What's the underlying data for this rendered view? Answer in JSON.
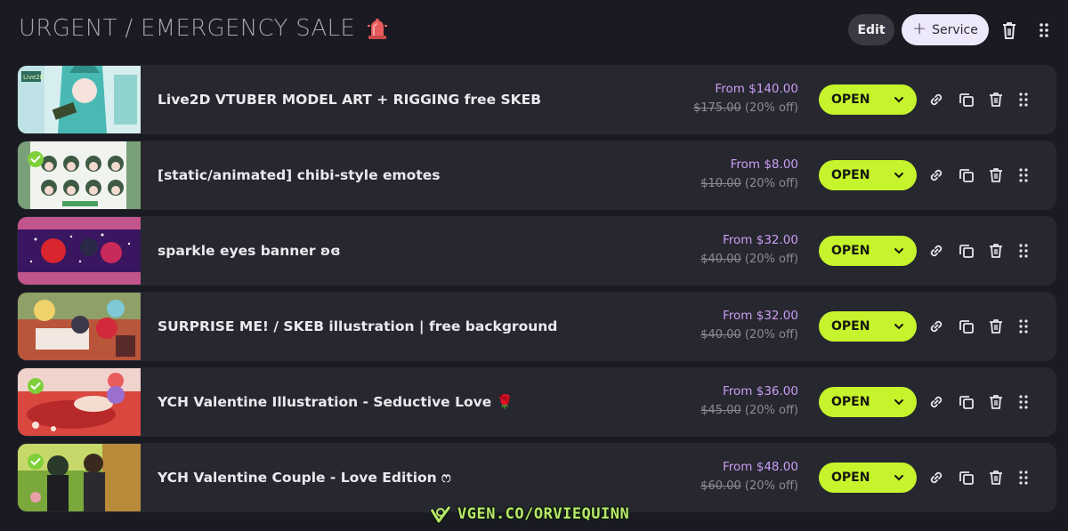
{
  "header": {
    "title": "URGENT / EMERGENCY SALE",
    "siren_icon": "police-siren-icon",
    "edit_label": "Edit",
    "service_label": "Service",
    "service_icon": "plus-icon"
  },
  "colors": {
    "background": "#1a1a23",
    "row_background": "#272730",
    "accent_open": "#c6f42c",
    "price_from": "#c99ef2",
    "price_orig": "#8b8b95",
    "service_button": "#eee8fb"
  },
  "services": [
    {
      "name": "Live2D VTUBER MODEL ART + RIGGING free SKEB",
      "from": "From $140.00",
      "original": "$175.00",
      "discount": "(20% off)",
      "status": "OPEN",
      "verified": false
    },
    {
      "name": "[static/animated] chibi-style emotes",
      "from": "From $8.00",
      "original": "$10.00",
      "discount": "(20% off)",
      "status": "OPEN",
      "verified": true
    },
    {
      "name": "sparkle eyes banner ʚɞ",
      "from": "From $32.00",
      "original": "$40.00",
      "discount": "(20% off)",
      "status": "OPEN",
      "verified": false
    },
    {
      "name": "SURPRISE ME! / SKEB illustration | free background",
      "from": "From $32.00",
      "original": "$40.00",
      "discount": "(20% off)",
      "status": "OPEN",
      "verified": false
    },
    {
      "name": "YCH Valentine Illustration - Seductive Love 🌹",
      "from": "From $36.00",
      "original": "$45.00",
      "discount": "(20% off)",
      "status": "OPEN",
      "verified": true
    },
    {
      "name": "YCH Valentine Couple - Love Edition ෆ",
      "from": "From $48.00",
      "original": "$60.00",
      "discount": "(20% off)",
      "status": "OPEN",
      "verified": true
    }
  ],
  "watermark": {
    "text": "VGEN.CO/ORVIEQUINN",
    "icon": "vgen-logo-icon"
  }
}
